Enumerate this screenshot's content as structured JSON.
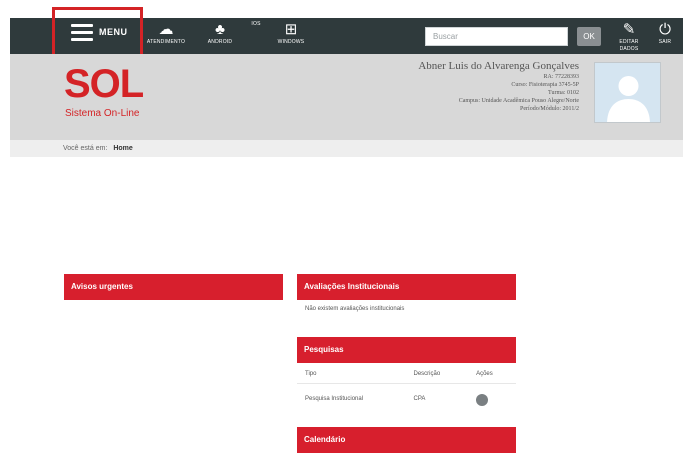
{
  "topbar": {
    "menu_label": "MENU",
    "items": [
      {
        "label": "ATENDIMENTO",
        "icon": "chat-icon"
      },
      {
        "label": "ANDROID",
        "icon": "android-icon"
      },
      {
        "label": "IOS",
        "icon": "apple-icon"
      },
      {
        "label": "WINDOWS",
        "icon": "windows-icon"
      }
    ],
    "search_placeholder": "Buscar",
    "ok_label": "OK",
    "right_items": [
      {
        "label": "EDITAR DADOS",
        "icon": "edit-icon"
      },
      {
        "label": "SAIR",
        "icon": "power-icon"
      }
    ]
  },
  "header": {
    "logo_text": "SOL",
    "logo_sub": "Sistema On-Line",
    "user_name": "Abner Luis do Alvarenga Gonçalves",
    "lines": [
      "RA: 77228393",
      "Curso: Fisioterapia 3745-5P",
      "Turma: 0102",
      "Campus: Unidade Acadêmica Pouso Alegre/Norte",
      "Período/Módulo: 2011/2"
    ]
  },
  "breadcrumb": {
    "prefix": "Você está em:",
    "current": "Home"
  },
  "panels": {
    "avisos": {
      "title": "Avisos urgentes"
    },
    "avaliacoes": {
      "title": "Avaliações Institucionais",
      "body": "Não existem avaliações institucionais"
    },
    "pesquisas": {
      "title": "Pesquisas",
      "columns": [
        "Tipo",
        "Descrição",
        "Ações"
      ],
      "rows": [
        [
          "Pesquisa Institucional",
          "CPA"
        ]
      ]
    },
    "calendario": {
      "title": "Calendário"
    }
  }
}
